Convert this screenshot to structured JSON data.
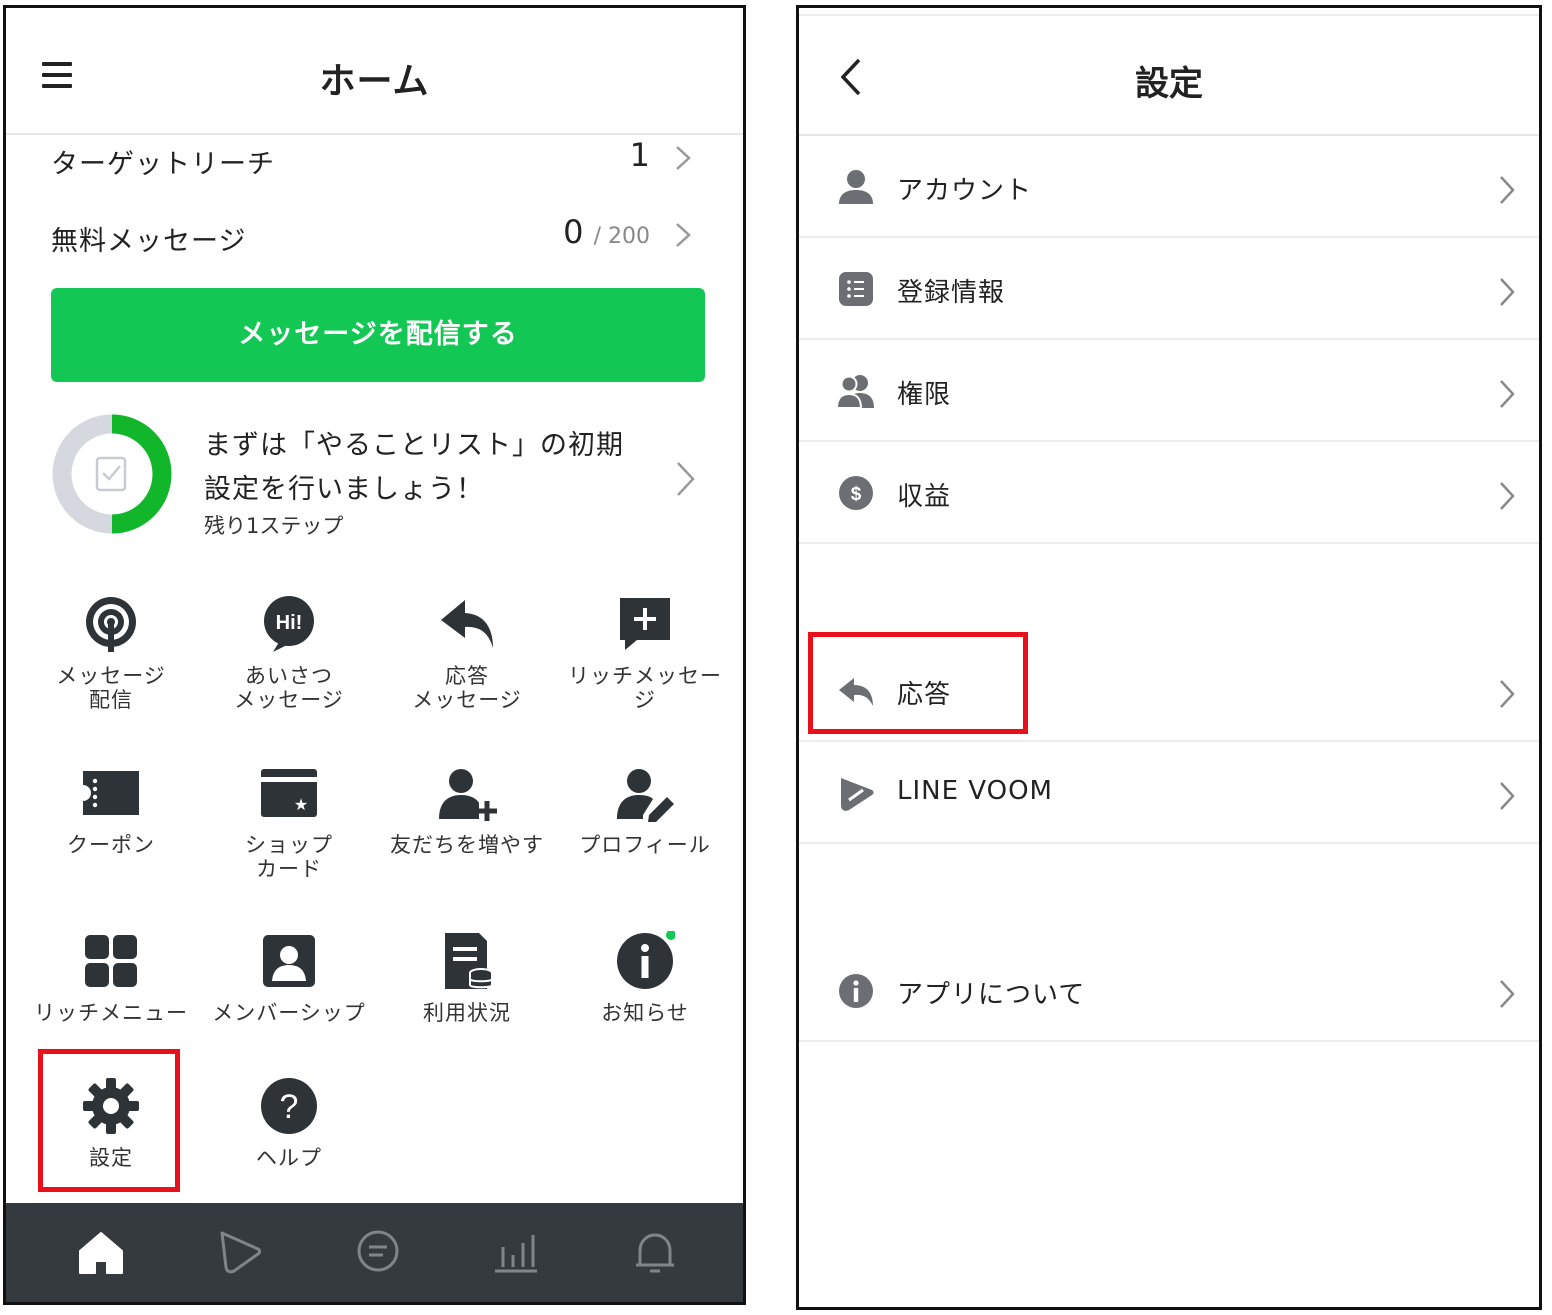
{
  "left_screen": {
    "header": {
      "title": "ホーム",
      "menu_icon": "hamburger-icon"
    },
    "stats": [
      {
        "label": "ターゲットリーチ",
        "value": "1",
        "suffix": ""
      },
      {
        "label": "無料メッセージ",
        "value": "0",
        "suffix": "/ 200"
      }
    ],
    "send_button": "メッセージを配信する",
    "todo": {
      "line1": "まずは「やることリスト」の初期",
      "line2": "設定を行いましょう！",
      "steps": "残り1ステップ",
      "progress_percent": 50
    },
    "tiles": [
      {
        "label": "メッセージ\n配信",
        "icon": "broadcast-icon"
      },
      {
        "label": "あいさつ\nメッセージ",
        "icon": "greeting-bubble-icon"
      },
      {
        "label": "応答\nメッセージ",
        "icon": "reply-arrow-icon"
      },
      {
        "label": "リッチメッセー\nジ",
        "icon": "rich-message-icon"
      },
      {
        "label": "クーポン",
        "icon": "coupon-icon"
      },
      {
        "label": "ショップ\nカード",
        "icon": "shop-card-icon"
      },
      {
        "label": "友だちを増やす",
        "icon": "add-friend-icon"
      },
      {
        "label": "プロフィール",
        "icon": "profile-edit-icon"
      },
      {
        "label": "リッチメニュー",
        "icon": "rich-menu-icon"
      },
      {
        "label": "メンバーシップ",
        "icon": "membership-icon"
      },
      {
        "label": "利用状況",
        "icon": "usage-icon"
      },
      {
        "label": "お知らせ",
        "icon": "info-notice-icon"
      },
      {
        "label": "設定",
        "icon": "gear-icon"
      },
      {
        "label": "ヘルプ",
        "icon": "help-icon"
      }
    ],
    "tabbar": [
      "home-icon",
      "voom-icon",
      "chat-icon",
      "analytics-icon",
      "bell-icon"
    ],
    "colors": {
      "accent": "#12c753",
      "highlight": "#e8101a",
      "tabbar": "#353a3f"
    }
  },
  "right_screen": {
    "header": {
      "title": "設定",
      "back_icon": "back-arrow-icon"
    },
    "items": [
      {
        "label": "アカウント",
        "icon": "account-icon"
      },
      {
        "label": "登録情報",
        "icon": "list-icon"
      },
      {
        "label": "権限",
        "icon": "users-icon"
      },
      {
        "label": "収益",
        "icon": "dollar-icon"
      },
      {
        "label": "応答",
        "icon": "reply-icon"
      },
      {
        "label": "LINE VOOM",
        "icon": "voom-icon"
      },
      {
        "label": "アプリについて",
        "icon": "info-icon"
      }
    ]
  }
}
